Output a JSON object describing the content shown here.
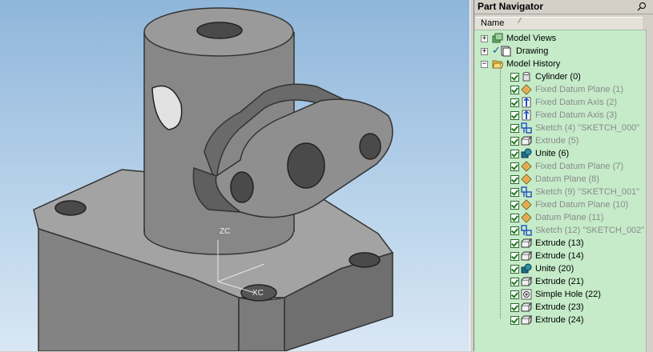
{
  "navigator": {
    "title": "Part Navigator",
    "column_name": "Name",
    "sort_glyph": "⁄",
    "top_nodes": [
      {
        "label": "Model Views",
        "expander": "+",
        "icon": "model-views-icon"
      },
      {
        "label": "Drawing",
        "expander": "+",
        "icon": "drawing-icon",
        "checked": true
      },
      {
        "label": "Model History",
        "expander": "−",
        "icon": "folder-open-icon"
      }
    ],
    "history": [
      {
        "label": "Cylinder (0)",
        "icon": "cylinder",
        "active": true
      },
      {
        "label": "Fixed Datum Plane (1)",
        "icon": "datum-plane",
        "active": false
      },
      {
        "label": "Fixed Datum Axis (2)",
        "icon": "datum-axis",
        "active": false
      },
      {
        "label": "Fixed Datum Axis (3)",
        "icon": "datum-axis",
        "active": false
      },
      {
        "label": "Sketch (4) \"SKETCH_000\"",
        "icon": "sketch",
        "active": false
      },
      {
        "label": "Extrude (5)",
        "icon": "extrude",
        "active": false
      },
      {
        "label": "Unite (6)",
        "icon": "unite",
        "active": true
      },
      {
        "label": "Fixed Datum Plane (7)",
        "icon": "datum-plane",
        "active": false
      },
      {
        "label": "Datum Plane (8)",
        "icon": "datum-plane",
        "active": false
      },
      {
        "label": "Sketch (9) \"SKETCH_001\"",
        "icon": "sketch",
        "active": false
      },
      {
        "label": "Fixed Datum Plane (10)",
        "icon": "datum-plane",
        "active": false
      },
      {
        "label": "Datum Plane (11)",
        "icon": "datum-plane",
        "active": false
      },
      {
        "label": "Sketch (12) \"SKETCH_002\"",
        "icon": "sketch",
        "active": false
      },
      {
        "label": "Extrude (13)",
        "icon": "extrude",
        "active": true
      },
      {
        "label": "Extrude (14)",
        "icon": "extrude",
        "active": true
      },
      {
        "label": "Unite (20)",
        "icon": "unite",
        "active": true
      },
      {
        "label": "Extrude (21)",
        "icon": "extrude",
        "active": true
      },
      {
        "label": "Simple Hole (22)",
        "icon": "hole",
        "active": true
      },
      {
        "label": "Extrude (23)",
        "icon": "extrude",
        "active": true
      },
      {
        "label": "Extrude (24)",
        "icon": "extrude",
        "active": true
      }
    ]
  },
  "viewport": {
    "triad": {
      "z_label": "ZC",
      "x_label": "XC"
    }
  },
  "colors": {
    "tree_bg": "#c5ebc9",
    "inactive_text": "#8a8a8a",
    "part_gray": "#8a8a8a"
  }
}
